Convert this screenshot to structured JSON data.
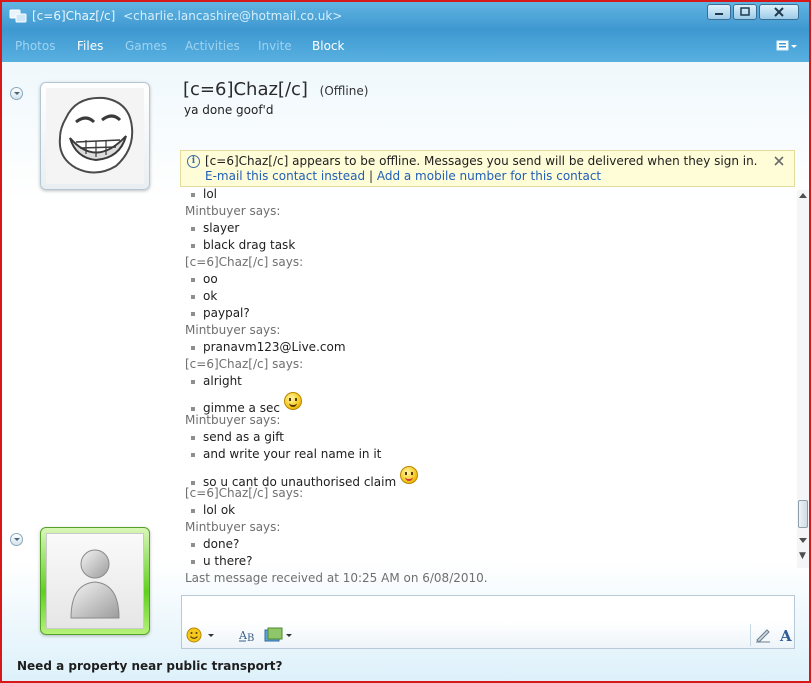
{
  "window": {
    "title": "[c=6]Chaz[/c]",
    "email": "<charlie.lancashire@hotmail.co.uk>"
  },
  "menu": {
    "items": [
      "Photos",
      "Files",
      "Games",
      "Activities",
      "Invite",
      "Block"
    ],
    "active_index": 1
  },
  "contact": {
    "name": "[c=6]Chaz[/c]",
    "status": "(Offline)",
    "personal_message": "ya done goof'd"
  },
  "infobar": {
    "message": "[c=6]Chaz[/c] appears to be offline. Messages you send will be delivered when they sign in.",
    "email_link": "E-mail this contact instead",
    "separator": "|",
    "mobile_link": "Add a mobile number for this contact"
  },
  "conversation": {
    "lines": [
      {
        "kind": "message",
        "text": "lol"
      },
      {
        "kind": "sender",
        "text": "Mintbuyer says:"
      },
      {
        "kind": "message",
        "text": "slayer"
      },
      {
        "kind": "message",
        "text": "black drag task"
      },
      {
        "kind": "sender",
        "text": "[c=6]Chaz[/c] says:"
      },
      {
        "kind": "message",
        "text": "oo"
      },
      {
        "kind": "message",
        "text": "ok"
      },
      {
        "kind": "message",
        "text": "paypal?"
      },
      {
        "kind": "sender",
        "text": "Mintbuyer says:"
      },
      {
        "kind": "message",
        "text": "pranavm123@Live.com"
      },
      {
        "kind": "sender",
        "text": "[c=6]Chaz[/c] says:"
      },
      {
        "kind": "message",
        "text": "alright"
      },
      {
        "kind": "message",
        "text": "gimme a sec",
        "emoticon": "smile-emoticon"
      },
      {
        "kind": "sender",
        "text": "Mintbuyer says:"
      },
      {
        "kind": "message",
        "text": "send as a gift"
      },
      {
        "kind": "message",
        "text": "and write your real name in it"
      },
      {
        "kind": "message",
        "text": "so u cant do unauthorised claim",
        "emoticon": "tongue-emoticon"
      },
      {
        "kind": "sender",
        "text": "[c=6]Chaz[/c] says:"
      },
      {
        "kind": "message",
        "text": "lol ok"
      },
      {
        "kind": "sender",
        "text": "Mintbuyer says:"
      },
      {
        "kind": "message",
        "text": "done?"
      },
      {
        "kind": "message",
        "text": "u there?"
      }
    ],
    "last_received": "Last message received at 10:25 AM on 6/08/2010."
  },
  "compose": {
    "value": ""
  },
  "ad": {
    "text": "Need a property near public transport?"
  }
}
